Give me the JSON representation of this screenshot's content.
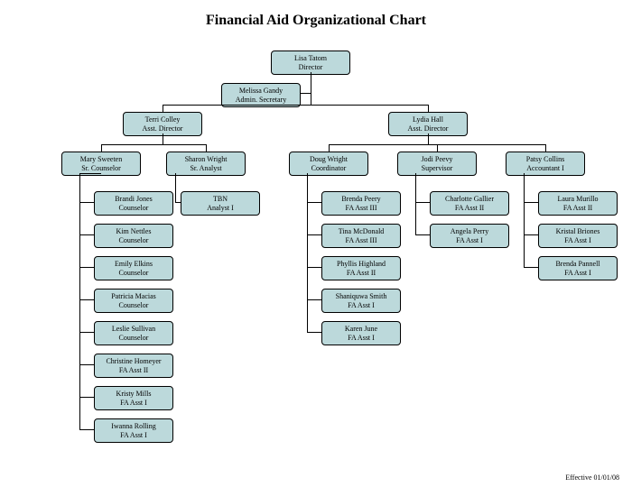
{
  "title": "Financial Aid Organizational Chart",
  "footer": "Effective 01/01/08",
  "boxes": {
    "director": {
      "name": "Lisa Tatom",
      "role": "Director"
    },
    "secretary": {
      "name": "Melissa Gandy",
      "role": "Admin. Secretary"
    },
    "adirL": {
      "name": "Terri Colley",
      "role": "Asst. Director"
    },
    "adirR": {
      "name": "Lydia Hall",
      "role": "Asst. Director"
    },
    "srcoun": {
      "name": "Mary Sweeten",
      "role": "Sr. Counselor"
    },
    "sranal": {
      "name": "Sharon Wright",
      "role": "Sr. Analyst"
    },
    "coord": {
      "name": "Doug Wright",
      "role": "Coordinator"
    },
    "super": {
      "name": "Jodi Peevy",
      "role": "Supervisor"
    },
    "acct": {
      "name": "Patsy Collins",
      "role": "Accountant I"
    },
    "c1": {
      "name": "Brandi Jones",
      "role": "Counselor"
    },
    "c2": {
      "name": "Kim Nettles",
      "role": "Counselor"
    },
    "c3": {
      "name": "Emily Elkins",
      "role": "Counselor"
    },
    "c4": {
      "name": "Patricia Macias",
      "role": "Counselor"
    },
    "c5": {
      "name": "Leslie Sullivan",
      "role": "Counselor"
    },
    "c6": {
      "name": "Christine Homeyer",
      "role": "FA Asst II"
    },
    "c7": {
      "name": "Kristy Mills",
      "role": "FA Asst I"
    },
    "c8": {
      "name": "Iwanna Rolling",
      "role": "FA Asst I"
    },
    "a1": {
      "name": "TBN",
      "role": "Analyst I"
    },
    "d1": {
      "name": "Brenda Peery",
      "role": "FA Asst III"
    },
    "d2": {
      "name": "Tina McDonald",
      "role": "FA Asst III"
    },
    "d3": {
      "name": "Phyllis Highland",
      "role": "FA Asst II"
    },
    "d4": {
      "name": "Shaniquwa Smith",
      "role": "FA Asst I"
    },
    "d5": {
      "name": "Karen June",
      "role": "FA Asst I"
    },
    "s1": {
      "name": "Charlotte Gallier",
      "role": "FA Asst II"
    },
    "s2": {
      "name": "Angela Perry",
      "role": "FA Asst I"
    },
    "p1": {
      "name": "Laura Murillo",
      "role": "FA Asst II"
    },
    "p2": {
      "name": "Kristal Briones",
      "role": "FA Asst I"
    },
    "p3": {
      "name": "Brenda Pannell",
      "role": "FA Asst I"
    }
  }
}
